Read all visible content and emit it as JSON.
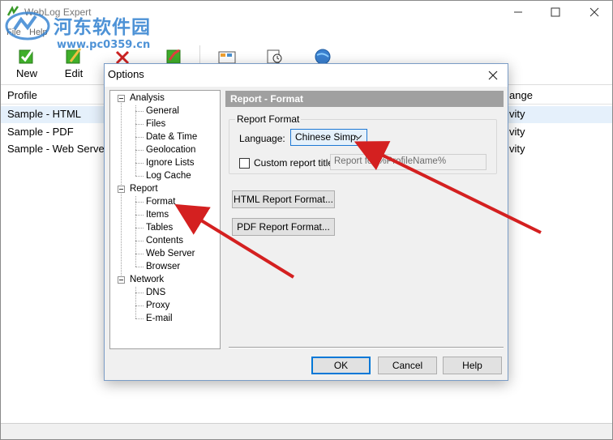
{
  "app": {
    "title": "WebLog Expert",
    "menu": [
      "File",
      "Help"
    ],
    "toolbar": [
      {
        "label": "New",
        "icon": "new-profile-icon"
      },
      {
        "label": "Edit",
        "icon": "edit-profile-icon"
      },
      {
        "label": "",
        "icon": "delete-profile-icon"
      },
      {
        "label": "",
        "icon": "analyze-icon"
      },
      {
        "label": "",
        "icon": "report-icon"
      },
      {
        "label": "",
        "icon": "schedule-icon"
      },
      {
        "label": "",
        "icon": "web-icon"
      }
    ],
    "columns": {
      "profile": "Profile",
      "range": "ange"
    },
    "profiles": [
      {
        "name": "Sample - HTML",
        "range": "vity"
      },
      {
        "name": "Sample - PDF",
        "range": "vity"
      },
      {
        "name": "Sample - Web Serve",
        "range": "vity"
      }
    ]
  },
  "watermark": {
    "text": "河东软件园",
    "url": "www.pc0359.cn"
  },
  "dialog": {
    "title": "Options",
    "tree": {
      "analysis": {
        "label": "Analysis",
        "children": [
          "General",
          "Files",
          "Date & Time",
          "Geolocation",
          "Ignore Lists",
          "Log Cache"
        ]
      },
      "report": {
        "label": "Report",
        "children": [
          "Format",
          "Items",
          "Tables",
          "Contents",
          "Web Server",
          "Browser"
        ]
      },
      "network": {
        "label": "Network",
        "children": [
          "DNS",
          "Proxy",
          "E-mail"
        ]
      }
    },
    "section_header": "Report - Format",
    "group_caption": "Report Format",
    "language_label": "Language:",
    "language_value": "Chinese Simp.",
    "custom_title_label": "Custom report title:",
    "custom_title_checked": false,
    "custom_title_placeholder": "Report for %ProfileName%",
    "html_button": "HTML Report Format...",
    "pdf_button": "PDF Report Format...",
    "ok": "OK",
    "cancel": "Cancel",
    "help": "Help"
  },
  "colors": {
    "annotation_arrow": "#d42020",
    "selection": "#e5f0fb",
    "accent": "#0078d7"
  }
}
